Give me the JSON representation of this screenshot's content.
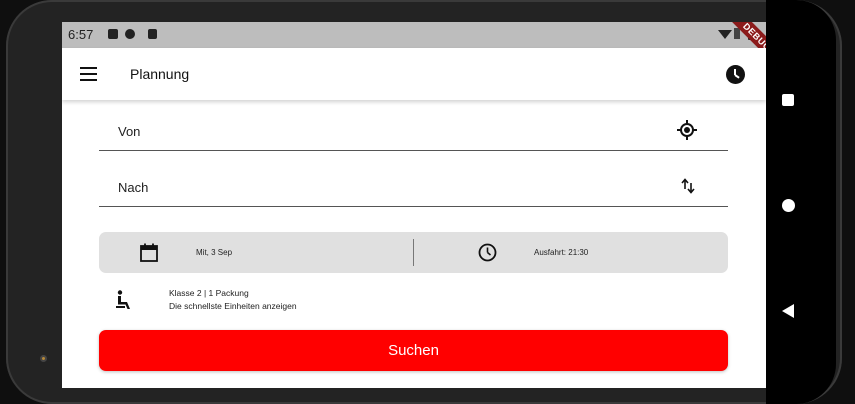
{
  "status_bar": {
    "time": "6:57"
  },
  "debug_banner": "DEBUG",
  "app_bar": {
    "title": "Plannung",
    "menu_icon": "menu-icon",
    "history_icon": "history-icon"
  },
  "form": {
    "from_label": "Von",
    "to_label": "Nach",
    "date": "Mit, 3 Sep",
    "departure": "Ausfahrt: 21:30",
    "class_line": "Klasse 2  |  1 Packung",
    "option_line": "Die schnellste Einheiten anzeigen",
    "search_label": "Suchen"
  },
  "colors": {
    "accent": "#ff0000",
    "datetime_bg": "#e0e0e0",
    "status_bar": "#bdbdbd"
  }
}
